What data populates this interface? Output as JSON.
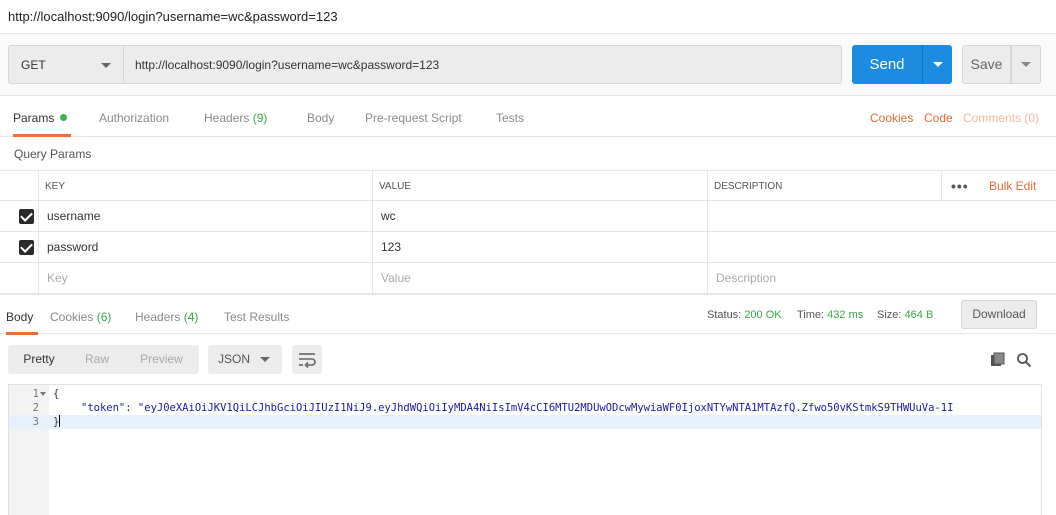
{
  "window": {
    "title": "http://localhost:9090/login?username=wc&password=123"
  },
  "request": {
    "method": "GET",
    "url": "http://localhost:9090/login?username=wc&password=123",
    "send_label": "Send",
    "save_label": "Save"
  },
  "request_tabs": {
    "params": "Params",
    "authorization": "Authorization",
    "headers": "Headers",
    "headers_count": "(9)",
    "body": "Body",
    "pre_request": "Pre-request Script",
    "tests": "Tests",
    "cookies": "Cookies",
    "code": "Code",
    "comments": "Comments (0)"
  },
  "query_params": {
    "label": "Query Params",
    "columns": {
      "key": "KEY",
      "value": "VALUE",
      "description": "DESCRIPTION"
    },
    "bulk_edit": "Bulk Edit",
    "rows": [
      {
        "key": "username",
        "value": "wc",
        "description": "",
        "checked": true
      },
      {
        "key": "password",
        "value": "123",
        "description": "",
        "checked": true
      }
    ],
    "placeholders": {
      "key": "Key",
      "value": "Value",
      "description": "Description"
    }
  },
  "response_tabs": {
    "body": "Body",
    "cookies": "Cookies",
    "cookies_count": "(6)",
    "headers": "Headers",
    "headers_count": "(4)",
    "test_results": "Test Results"
  },
  "response_status": {
    "status_label": "Status:",
    "status_value": "200 OK",
    "time_label": "Time:",
    "time_value": "432 ms",
    "size_label": "Size:",
    "size_value": "464 B",
    "download": "Download"
  },
  "response_view": {
    "pretty": "Pretty",
    "raw": "Raw",
    "preview": "Preview",
    "format": "JSON"
  },
  "response_body": {
    "lines": [
      {
        "num": "1",
        "text": "{"
      },
      {
        "num": "2",
        "key": "\"token\"",
        "sep": ": ",
        "value": "\"eyJ0eXAiOiJKV1QiLCJhbGciOiJIUzI1NiJ9.eyJhdWQiOiIyMDA4NiIsImV4cCI6MTU2MDUwODcwMywiaWF0IjoxNTYwNTA1MTAzfQ.Zfwo50vKStmkS9THWUuVa-1I"
      },
      {
        "num": "3",
        "text": "}"
      }
    ]
  },
  "colors": {
    "accent": "#f26b3a",
    "primary": "#1c8be0",
    "success": "#3aa64a"
  }
}
